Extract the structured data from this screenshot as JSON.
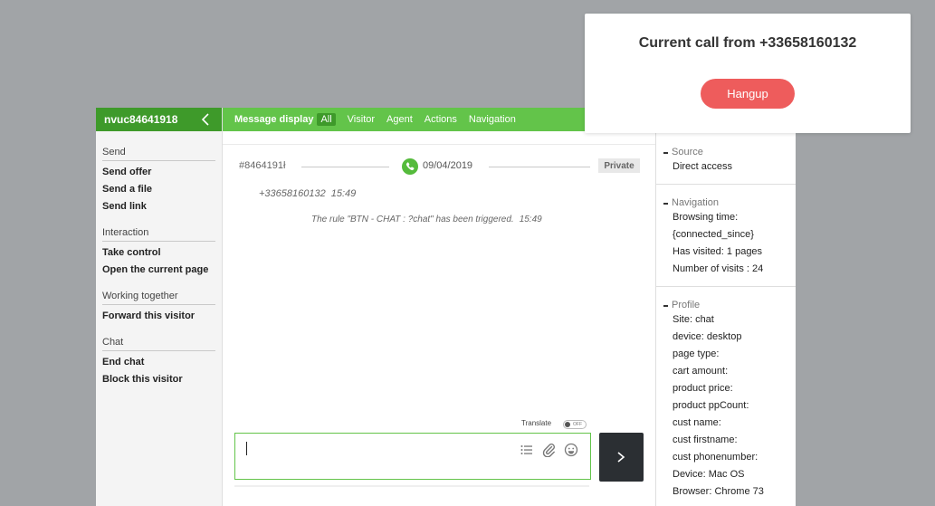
{
  "visitor": {
    "id": "nvuc84641918"
  },
  "sidebar": {
    "sections": [
      {
        "title": "Send",
        "items": [
          "Send offer",
          "Send a file",
          "Send link"
        ]
      },
      {
        "title": "Interaction",
        "items": [
          "Take control",
          "Open the current page"
        ]
      },
      {
        "title": "Working together",
        "items": [
          "Forward this visitor"
        ]
      },
      {
        "title": "Chat",
        "items": [
          "End chat",
          "Block this visitor"
        ]
      }
    ]
  },
  "topbar": {
    "label": "Message display",
    "tabs": [
      "All",
      "Visitor",
      "Agent",
      "Actions",
      "Navigation"
    ]
  },
  "conversation": {
    "id": "#8464191ł",
    "date": "09/04/2019",
    "badge": "Private",
    "messages": [
      {
        "text": "+33658160132",
        "time": "15:49"
      },
      {
        "text": "The rule \"BTN - CHAT : ?chat\" has been triggered.",
        "time": "15:49"
      }
    ]
  },
  "composer": {
    "translate_label": "Translate",
    "toggle_state": "OFF"
  },
  "details": {
    "source": {
      "title": "Source",
      "items": [
        "Direct access"
      ]
    },
    "navigation": {
      "title": "Navigation",
      "items": [
        "Browsing time:",
        "{connected_since}",
        "Has visited: 1 pages",
        "Number of visits : 24"
      ]
    },
    "profile": {
      "title": "Profile",
      "items": [
        "Site: chat",
        "device: desktop",
        "page type:",
        "cart amount:",
        "product price:",
        "product ppCount:",
        "cust name:",
        "cust firstname:",
        "cust phonenumber:",
        "Device: Mac OS",
        "Browser: Chrome 73"
      ]
    }
  },
  "call_popup": {
    "title": "Current call from +33658160132",
    "hangup_label": "Hangup"
  },
  "colors": {
    "header_dark_green": "#3e9a2a",
    "header_green": "#63c44a",
    "hangup_red": "#ee5c5c",
    "send_dark": "#2b2f33"
  }
}
